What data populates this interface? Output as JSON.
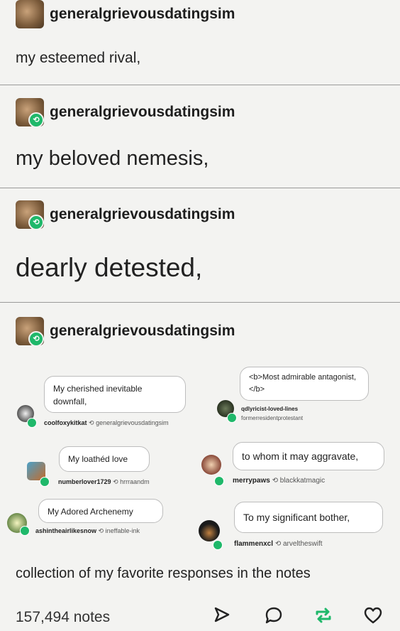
{
  "posts": [
    {
      "username": "generalgrievousdatingsim",
      "text": "my esteemed rival,"
    },
    {
      "username": "generalgrievousdatingsim",
      "text": "my beloved nemesis,"
    },
    {
      "username": "generalgrievousdatingsim",
      "text": "dearly detested,"
    },
    {
      "username": "generalgrievousdatingsim"
    }
  ],
  "notes": [
    {
      "text": "My cherished inevitable downfall,",
      "user": "coolfoxykitkat",
      "reblog": "generalgrievousdatingsim"
    },
    {
      "text": "<b>Most admirable antagonist,</b>",
      "user": "qdlyricist-loved-lines",
      "reblog": "formerresidentprotestant"
    },
    {
      "text": "My loathéd love",
      "user": "numberlover1729",
      "reblog": "hrrraandm"
    },
    {
      "text": "to whom it may aggravate,",
      "user": "merrypaws",
      "reblog": "blackkatmagic"
    },
    {
      "text": "My Adored Archenemy",
      "user": "ashintheairlikesnow",
      "reblog": "ineffable-ink"
    },
    {
      "text": "To my significant bother,",
      "user": "flammenxcl",
      "reblog": "arveltheswift"
    }
  ],
  "caption": "collection of my favorite responses in the notes",
  "footer": {
    "notes_count": "157,494 notes"
  },
  "icons": [
    "share-icon",
    "reply-icon",
    "reblog-icon",
    "like-icon"
  ]
}
